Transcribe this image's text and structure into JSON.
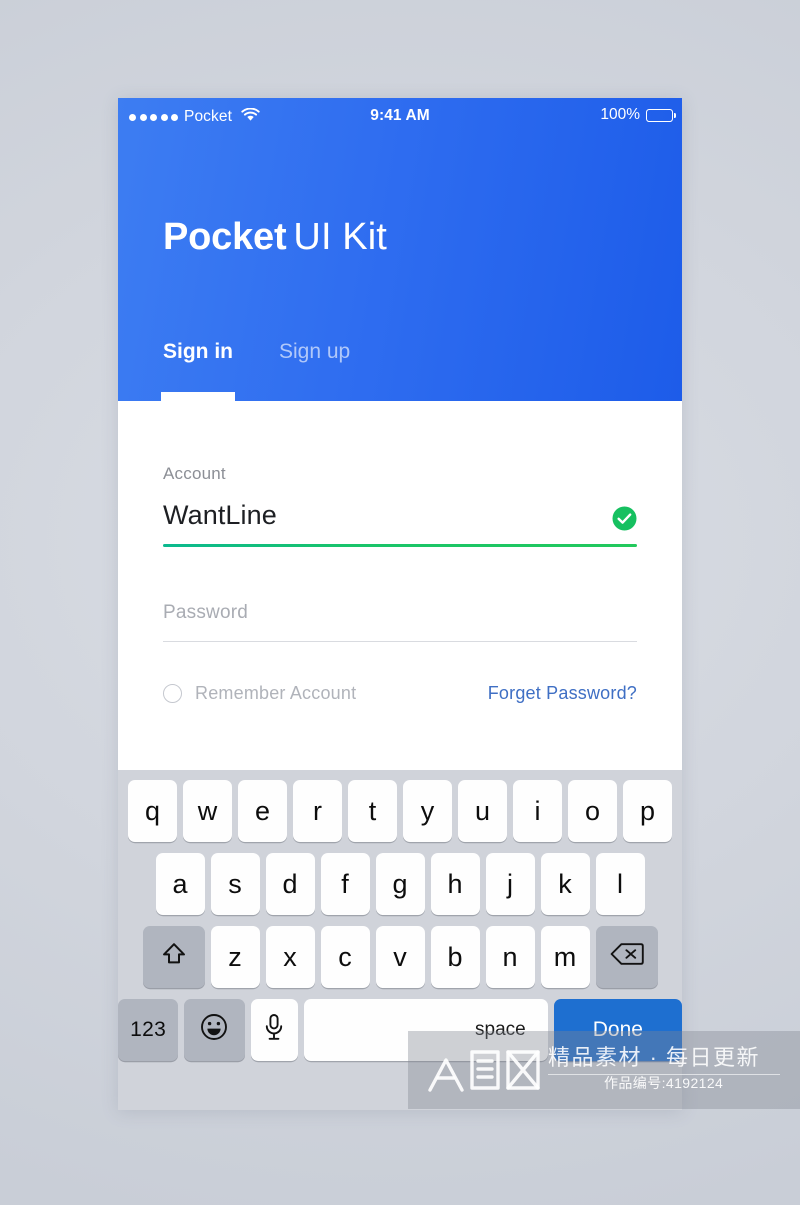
{
  "status_bar": {
    "signal_dots": 5,
    "carrier": "Pocket",
    "wifi_icon": "wifi-icon",
    "time": "9:41 AM",
    "battery_percent": "100%",
    "battery_icon": "battery-full-icon"
  },
  "header": {
    "title_strong": "Pocket",
    "title_light": "UI Kit",
    "gradient_from": "#3d7df2",
    "gradient_to": "#1d5ce9",
    "tabs": [
      {
        "label": "Sign in",
        "active": true
      },
      {
        "label": "Sign up",
        "active": false
      }
    ]
  },
  "form": {
    "account_label": "Account",
    "account_value": "WantLine",
    "account_valid_icon": "check-circle-icon",
    "account_underline_color": "#19c46a",
    "password_placeholder": "Password",
    "password_value": "",
    "remember_label": "Remember Account",
    "remember_checked": false,
    "forget_label": "Forget Password?",
    "forget_color": "#3f6fc4"
  },
  "keyboard": {
    "row1": [
      "q",
      "w",
      "e",
      "r",
      "t",
      "y",
      "u",
      "i",
      "o",
      "p"
    ],
    "row2": [
      "a",
      "s",
      "d",
      "f",
      "g",
      "h",
      "j",
      "k",
      "l"
    ],
    "row3_letters": [
      "z",
      "x",
      "c",
      "v",
      "b",
      "n",
      "m"
    ],
    "shift_icon": "shift-up-arrow-icon",
    "backspace_icon": "backspace-delete-icon",
    "numeric_label": "123",
    "emoji_icon": "smiley-face-icon",
    "dictation_icon": "microphone-icon",
    "space_label": "space",
    "done_label": "Done",
    "done_color": "#1e6fd0",
    "background_color": "#d0d3da"
  },
  "watermark": {
    "logo_icon": "zhongtuwang-logo-icon",
    "tagline": "精品素材 · 每日更新",
    "code": "作品编号:4192124"
  }
}
